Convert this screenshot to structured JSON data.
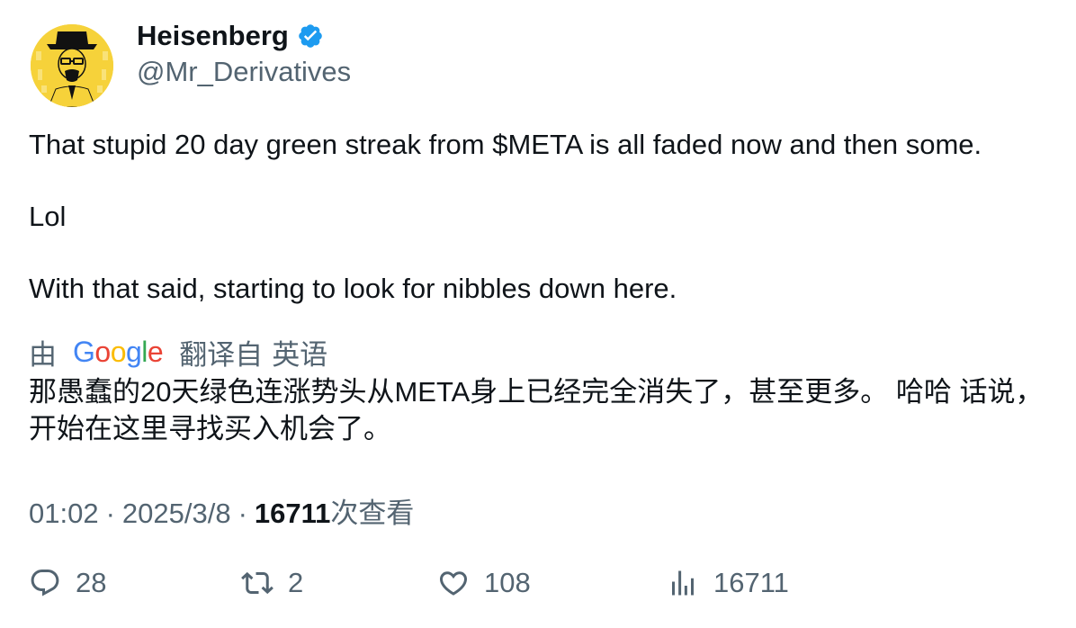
{
  "author": {
    "display_name": "Heisenberg",
    "handle": "@Mr_Derivatives",
    "verified": true,
    "avatar_icon": "heisenberg-avatar-icon"
  },
  "tweet": {
    "lines": [
      "That stupid 20 day green streak from $META is all faded now and then some.",
      "Lol",
      "With that said, starting to look for nibbles down here."
    ]
  },
  "translation": {
    "prefix": "由",
    "provider": "Google",
    "suffix": "翻译自",
    "language": "英语",
    "text": "那愚蠢的20天绿色连涨势头从META身上已经完全消失了，甚至更多。 哈哈 话说，开始在这里寻找买入机会了。"
  },
  "meta": {
    "time": "01:02",
    "separator": "·",
    "date": "2025/3/8",
    "views": "16711",
    "views_label": "次查看"
  },
  "actions": {
    "reply_count": "28",
    "retweet_count": "2",
    "like_count": "108",
    "views_count": "16711"
  },
  "colors": {
    "text": "#0f1419",
    "secondary": "#536471",
    "verified": "#1d9bf0",
    "avatar_bg": "#f6d23a"
  }
}
